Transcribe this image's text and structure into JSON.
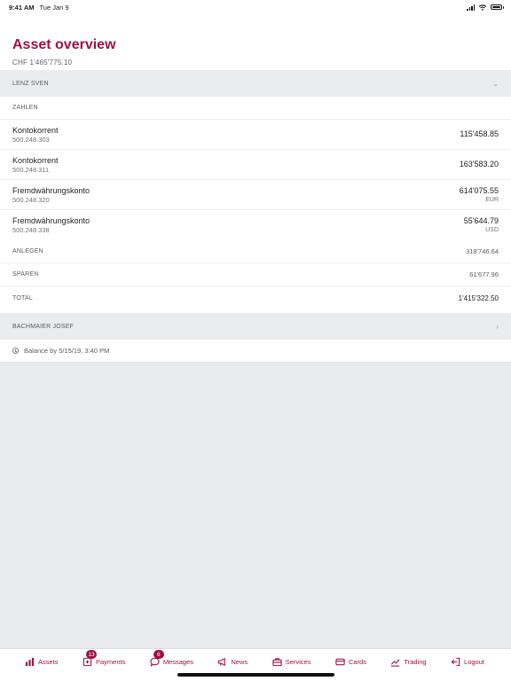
{
  "status": {
    "time": "9:41 AM",
    "date": "Tue Jan 9"
  },
  "header": {
    "title": "Asset overview",
    "total": "CHF 1'465'775.10"
  },
  "owners": [
    {
      "name": "LENZ SVEN",
      "sections": {
        "zahlen": "ZAHLEN",
        "accounts": [
          {
            "name": "Kontokorrent",
            "number": "500.248.303",
            "amount": "115'458.85",
            "currency": ""
          },
          {
            "name": "Kontokorrent",
            "number": "500.248.311",
            "amount": "163'583.20",
            "currency": ""
          },
          {
            "name": "Fremdwährungskonto",
            "number": "500.248.320",
            "amount": "614'075.55",
            "currency": "EUR"
          },
          {
            "name": "Fremdwährungskonto",
            "number": "500.248.338",
            "amount": "55'644.79",
            "currency": "USD"
          }
        ],
        "anlegen": {
          "label": "ANLEGEN",
          "value": "318'746.64"
        },
        "sparen": {
          "label": "SPAREN",
          "value": "61'677.96"
        },
        "total": {
          "label": "TOTAL",
          "value": "1'415'322.50"
        }
      }
    },
    {
      "name": "BACHMAIER JOSEF"
    }
  ],
  "balance_note": "Balance by 5/15/19, 3:40 PM",
  "tabs": [
    {
      "label": "Assets",
      "icon": "bar-chart-icon",
      "badge": ""
    },
    {
      "label": "Payments",
      "icon": "payments-icon",
      "badge": "13"
    },
    {
      "label": "Messages",
      "icon": "chat-bubble-icon",
      "badge": "6"
    },
    {
      "label": "News",
      "icon": "megaphone-icon",
      "badge": ""
    },
    {
      "label": "Services",
      "icon": "briefcase-icon",
      "badge": ""
    },
    {
      "label": "Cards",
      "icon": "credit-card-icon",
      "badge": ""
    },
    {
      "label": "Trading",
      "icon": "trading-chart-icon",
      "badge": ""
    },
    {
      "label": "Logout",
      "icon": "logout-icon",
      "badge": ""
    }
  ],
  "colors": {
    "accent": "#9e1343",
    "background": "#e9eaec",
    "section_bg": "#ebecee"
  }
}
